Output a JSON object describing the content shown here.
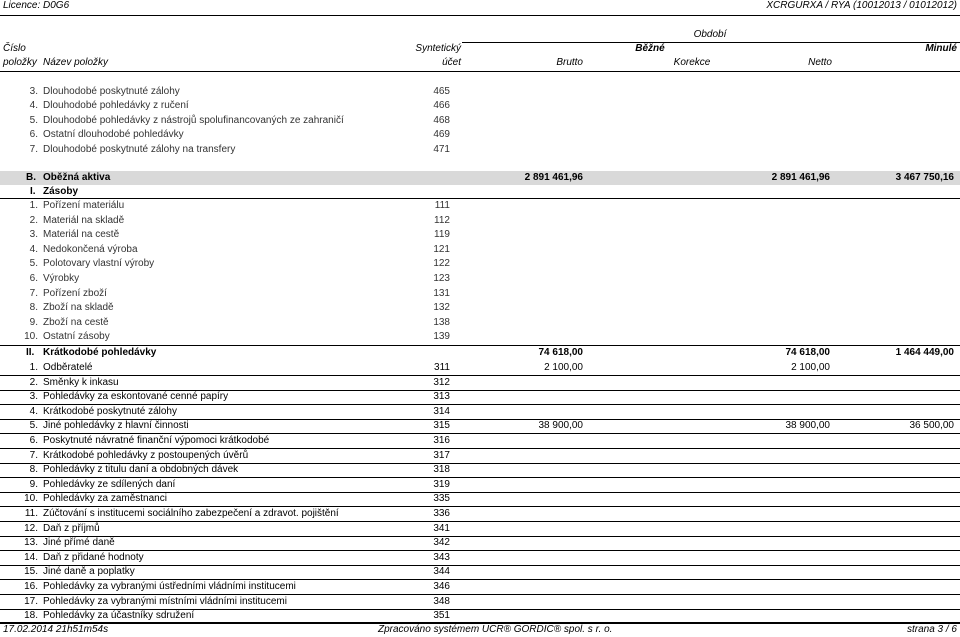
{
  "header": {
    "licence": "Licence: D0G6",
    "report_id": "XCRGURXA / RYA  (10012013 / 01012012)",
    "col_obdobi": "Období",
    "col_cislo": "Číslo",
    "col_polozky": "položky",
    "col_nazev": "Název položky",
    "col_synteticky": "Syntetický",
    "col_ucet": "účet",
    "col_bezne": "Běžné",
    "col_minule": "Minulé",
    "col_brutto": "Brutto",
    "col_korekce": "Korekce",
    "col_netto": "Netto"
  },
  "rows": [
    {
      "num": "3.",
      "name": "Dlouhodobé poskytnuté zálohy",
      "acct": "465",
      "brutto": "",
      "netto": "",
      "minule": ""
    },
    {
      "num": "4.",
      "name": "Dlouhodobé pohledávky z ručení",
      "acct": "466",
      "brutto": "",
      "netto": "",
      "minule": ""
    },
    {
      "num": "5.",
      "name": "Dlouhodobé pohledávky z nástrojů spolufinancovaných ze zahraničí",
      "acct": "468",
      "brutto": "",
      "netto": "",
      "minule": ""
    },
    {
      "num": "6.",
      "name": "Ostatní dlouhodobé pohledávky",
      "acct": "469",
      "brutto": "",
      "netto": "",
      "minule": ""
    },
    {
      "num": "7.",
      "name": "Dlouhodobé poskytnuté zálohy na transfery",
      "acct": "471",
      "brutto": "",
      "netto": "",
      "minule": ""
    }
  ],
  "section_b": {
    "code": "B.",
    "name": "Oběžná aktiva",
    "brutto": "2 891 461,96",
    "netto": "2 891 461,96",
    "minule": "3 467 750,16"
  },
  "section_i": {
    "code": "I.",
    "name": "Zásoby"
  },
  "rows_i": [
    {
      "num": "1.",
      "name": "Pořízení materiálu",
      "acct": "111",
      "brutto": "",
      "netto": "",
      "minule": ""
    },
    {
      "num": "2.",
      "name": "Materiál na skladě",
      "acct": "112",
      "brutto": "",
      "netto": "",
      "minule": ""
    },
    {
      "num": "3.",
      "name": "Materiál na cestě",
      "acct": "119",
      "brutto": "",
      "netto": "",
      "minule": ""
    },
    {
      "num": "4.",
      "name": "Nedokončená výroba",
      "acct": "121",
      "brutto": "",
      "netto": "",
      "minule": ""
    },
    {
      "num": "5.",
      "name": "Polotovary vlastní výroby",
      "acct": "122",
      "brutto": "",
      "netto": "",
      "minule": ""
    },
    {
      "num": "6.",
      "name": "Výrobky",
      "acct": "123",
      "brutto": "",
      "netto": "",
      "minule": ""
    },
    {
      "num": "7.",
      "name": "Pořízení zboží",
      "acct": "131",
      "brutto": "",
      "netto": "",
      "minule": ""
    },
    {
      "num": "8.",
      "name": "Zboží na skladě",
      "acct": "132",
      "brutto": "",
      "netto": "",
      "minule": ""
    },
    {
      "num": "9.",
      "name": "Zboží na cestě",
      "acct": "138",
      "brutto": "",
      "netto": "",
      "minule": ""
    },
    {
      "num": "10.",
      "name": "Ostatní zásoby",
      "acct": "139",
      "brutto": "",
      "netto": "",
      "minule": ""
    }
  ],
  "section_ii": {
    "code": "II.",
    "name": "Krátkodobé pohledávky",
    "brutto": "74 618,00",
    "netto": "74 618,00",
    "minule": "1 464 449,00"
  },
  "rows_ii": [
    {
      "num": "1.",
      "name": "Odběratelé",
      "acct": "311",
      "brutto": "2 100,00",
      "netto": "2 100,00",
      "minule": ""
    },
    {
      "num": "2.",
      "name": "Směnky k inkasu",
      "acct": "312",
      "brutto": "",
      "netto": "",
      "minule": ""
    },
    {
      "num": "3.",
      "name": "Pohledávky za eskontované cenné papíry",
      "acct": "313",
      "brutto": "",
      "netto": "",
      "minule": ""
    },
    {
      "num": "4.",
      "name": "Krátkodobé poskytnuté zálohy",
      "acct": "314",
      "brutto": "",
      "netto": "",
      "minule": ""
    },
    {
      "num": "5.",
      "name": "Jiné pohledávky z hlavní činnosti",
      "acct": "315",
      "brutto": "38 900,00",
      "netto": "38 900,00",
      "minule": "36 500,00"
    },
    {
      "num": "6.",
      "name": "Poskytnuté návratné finanční výpomoci krátkodobé",
      "acct": "316",
      "brutto": "",
      "netto": "",
      "minule": ""
    },
    {
      "num": "7.",
      "name": "Krátkodobé pohledávky z postoupených úvěrů",
      "acct": "317",
      "brutto": "",
      "netto": "",
      "minule": ""
    },
    {
      "num": "8.",
      "name": "Pohledávky z titulu daní a obdobných dávek",
      "acct": "318",
      "brutto": "",
      "netto": "",
      "minule": ""
    },
    {
      "num": "9.",
      "name": "Pohledávky ze sdílených daní",
      "acct": "319",
      "brutto": "",
      "netto": "",
      "minule": ""
    },
    {
      "num": "10.",
      "name": "Pohledávky za zaměstnanci",
      "acct": "335",
      "brutto": "",
      "netto": "",
      "minule": ""
    },
    {
      "num": "11.",
      "name": "Zúčtování s institucemi sociálního zabezpečení a zdravot. pojištění",
      "acct": "336",
      "brutto": "",
      "netto": "",
      "minule": ""
    },
    {
      "num": "12.",
      "name": "Daň z příjmů",
      "acct": "341",
      "brutto": "",
      "netto": "",
      "minule": ""
    },
    {
      "num": "13.",
      "name": "Jiné přímé daně",
      "acct": "342",
      "brutto": "",
      "netto": "",
      "minule": ""
    },
    {
      "num": "14.",
      "name": "Daň z přidané hodnoty",
      "acct": "343",
      "brutto": "",
      "netto": "",
      "minule": ""
    },
    {
      "num": "15.",
      "name": "Jiné daně a poplatky",
      "acct": "344",
      "brutto": "",
      "netto": "",
      "minule": ""
    },
    {
      "num": "16.",
      "name": "Pohledávky za vybranými ústředními vládními institucemi",
      "acct": "346",
      "brutto": "",
      "netto": "",
      "minule": ""
    },
    {
      "num": "17.",
      "name": "Pohledávky za vybranými místními vládními institucemi",
      "acct": "348",
      "brutto": "",
      "netto": "",
      "minule": ""
    },
    {
      "num": "18.",
      "name": "Pohledávky za účastníky sdružení",
      "acct": "351",
      "brutto": "",
      "netto": "",
      "minule": ""
    }
  ],
  "footer": {
    "timestamp": "17.02.2014 21h51m54s",
    "processed_by": "Zpracováno systémem UCR® GORDIC® spol. s  r. o.",
    "page": "strana 3 / 6"
  }
}
